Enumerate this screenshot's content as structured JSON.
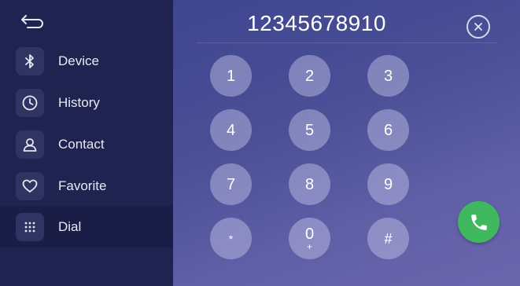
{
  "sidebar": {
    "back": {
      "icon": "back-arrow-icon"
    },
    "items": [
      {
        "label": "Device",
        "icon": "bluetooth-icon",
        "active": false
      },
      {
        "label": "History",
        "icon": "clock-icon",
        "active": false
      },
      {
        "label": "Contact",
        "icon": "person-icon",
        "active": false
      },
      {
        "label": "Favorite",
        "icon": "heart-icon",
        "active": false
      },
      {
        "label": "Dial",
        "icon": "dialpad-icon",
        "active": true
      }
    ]
  },
  "dialer": {
    "number": "12345678910",
    "clear_icon": "clear-icon",
    "keys": [
      {
        "digit": "1",
        "sub": ""
      },
      {
        "digit": "2",
        "sub": ""
      },
      {
        "digit": "3",
        "sub": ""
      },
      {
        "digit": "4",
        "sub": ""
      },
      {
        "digit": "5",
        "sub": ""
      },
      {
        "digit": "6",
        "sub": ""
      },
      {
        "digit": "7",
        "sub": ""
      },
      {
        "digit": "8",
        "sub": ""
      },
      {
        "digit": "9",
        "sub": ""
      },
      {
        "digit": "*",
        "sub": ""
      },
      {
        "digit": "0",
        "sub": "+"
      },
      {
        "digit": "#",
        "sub": ""
      }
    ],
    "call_icon": "phone-icon",
    "colors": {
      "call": "#3fb85f",
      "sidebar": "#1f2350"
    }
  }
}
